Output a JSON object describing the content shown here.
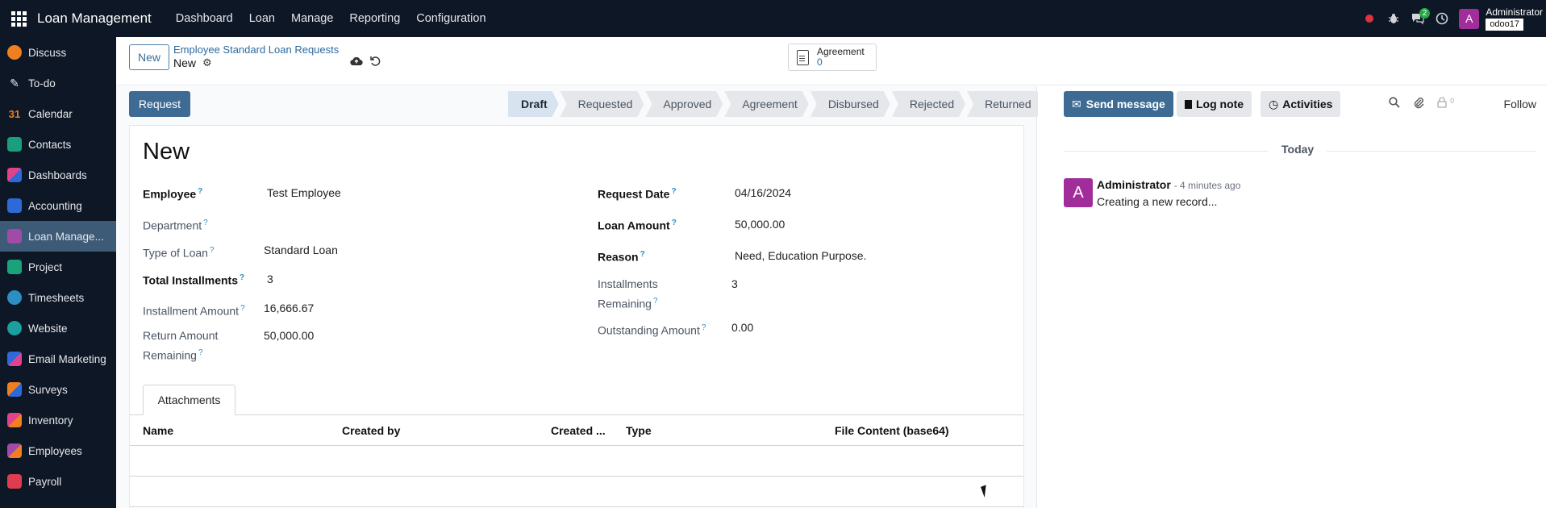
{
  "navbar": {
    "brand": "Loan Management",
    "menu": [
      "Dashboard",
      "Loan",
      "Manage",
      "Reporting",
      "Configuration"
    ],
    "messages_badge": "2",
    "user_initial": "A",
    "user_name": "Administrator",
    "db_name": "odoo17"
  },
  "sidebar": {
    "items": [
      {
        "label": "Discuss",
        "color": "#f07f22"
      },
      {
        "label": "To-do",
        "color": "#0e1726"
      },
      {
        "label": "Calendar",
        "color": "#0e1726"
      },
      {
        "label": "Contacts",
        "color": "#1a9e7e"
      },
      {
        "label": "Dashboards",
        "color": "#e0438c"
      },
      {
        "label": "Accounting",
        "color": "#2d6ad8"
      },
      {
        "label": "Loan Manage...",
        "color": "#a04ba8"
      },
      {
        "label": "Project",
        "color": "#1aa37a"
      },
      {
        "label": "Timesheets",
        "color": "#2d8ec4"
      },
      {
        "label": "Website",
        "color": "#1a9e9e"
      },
      {
        "label": "Email Marketing",
        "color": "#2d6ad8"
      },
      {
        "label": "Surveys",
        "color": "#f07f22"
      },
      {
        "label": "Inventory",
        "color": "#e0438c"
      },
      {
        "label": "Employees",
        "color": "#a04ba8"
      },
      {
        "label": "Payroll",
        "color": "#e03c4f"
      }
    ],
    "calendar_number": "31"
  },
  "control": {
    "new_label": "New",
    "breadcrumb": "Employee Standard Loan Requests",
    "current": "New",
    "smart_button_label": "Agreement",
    "smart_button_count": "0"
  },
  "form": {
    "request_label": "Request",
    "statuses": [
      "Draft",
      "Requested",
      "Approved",
      "Agreement",
      "Disbursed",
      "Rejected",
      "Returned"
    ],
    "current_status": "Draft",
    "title": "New",
    "fields": {
      "employee_label": "Employee",
      "employee_value": "Test Employee",
      "department_label": "Department",
      "type_label": "Type of Loan",
      "type_value": "Standard Loan",
      "total_inst_label": "Total Installments",
      "total_inst_value": "3",
      "inst_amount_label": "Installment Amount",
      "inst_amount_value": "16,666.67",
      "return_label_1": "Return Amount",
      "return_label_2": "Remaining",
      "return_value": "50,000.00",
      "request_date_label": "Request Date",
      "request_date_value": "04/16/2024",
      "loan_amount_label": "Loan Amount",
      "loan_amount_value": "50,000.00",
      "reason_label": "Reason",
      "reason_value": "Need, Education Purpose.",
      "inst_rem_label_1": "Installments",
      "inst_rem_label_2": "Remaining",
      "inst_rem_value": "3",
      "outstanding_label": "Outstanding Amount",
      "outstanding_value": "0.00"
    },
    "tab_label": "Attachments",
    "table_headers": [
      "Name",
      "Created by",
      "Created ...",
      "Type",
      "File Content (base64)"
    ]
  },
  "chatter": {
    "send_message": "Send message",
    "log_note": "Log note",
    "activities": "Activities",
    "follower_count": "0",
    "follow": "Follow",
    "day": "Today",
    "author_initial": "A",
    "author": "Administrator",
    "time": "- 4 minutes ago",
    "body": "Creating a new record..."
  }
}
